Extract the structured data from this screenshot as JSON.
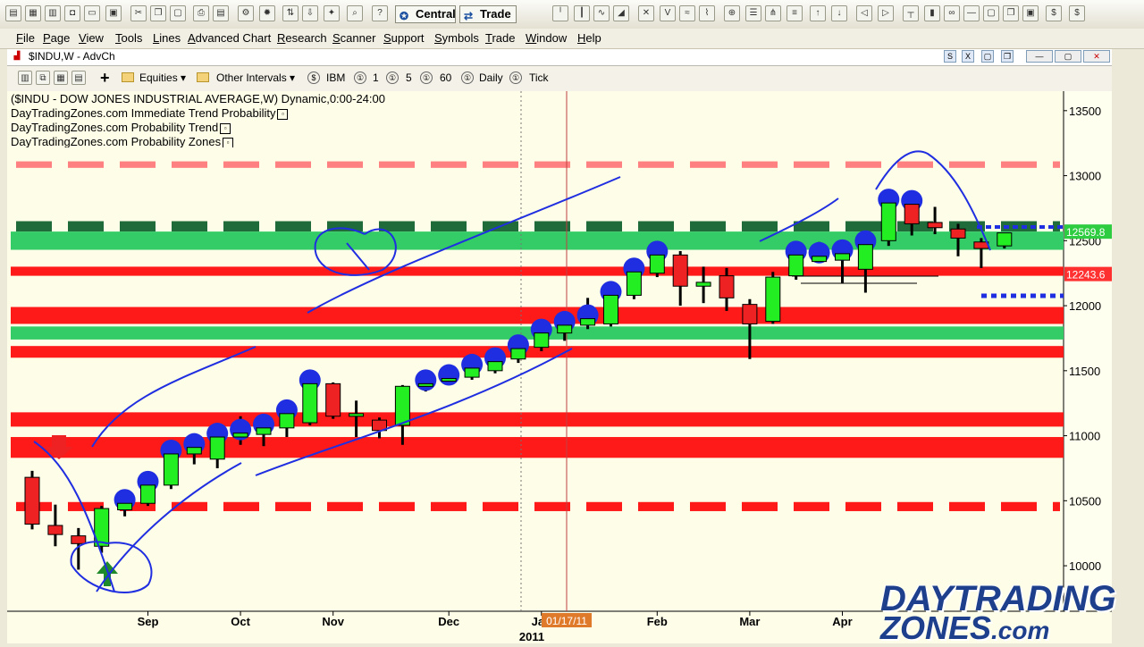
{
  "toolbar": {
    "central_label": "Central",
    "trade_label": "Trade"
  },
  "menu": [
    "File",
    "Page",
    "View",
    "Tools",
    "Lines",
    "Advanced Chart",
    "Research",
    "Scanner",
    "Support",
    "Symbols",
    "Trade",
    "Window",
    "Help"
  ],
  "window": {
    "title": "$INDU,W - AdvCh"
  },
  "chart_toolbar": {
    "equities": "Equities",
    "other_intervals": "Other Intervals",
    "symbol": "IBM",
    "intervals": [
      "1",
      "5",
      "60"
    ],
    "daily": "Daily",
    "tick": "Tick"
  },
  "overlay": {
    "line1": "($INDU - DOW JONES INDUSTRIAL AVERAGE,W) Dynamic,0:00-24:00",
    "line2": "DayTradingZones.com Immediate Trend Probability",
    "line3": "DayTradingZones.com Probability Trend",
    "line4": "DayTradingZones.com Probability Zones"
  },
  "chart_data": {
    "type": "candlestick",
    "y_ticks": [
      13500,
      13000,
      12500,
      12000,
      11500,
      11000,
      10500,
      10000
    ],
    "ylim": [
      9650,
      13650
    ],
    "x_labels": [
      {
        "label": "Sep",
        "index": 5
      },
      {
        "label": "Oct",
        "index": 9
      },
      {
        "label": "Nov",
        "index": 13
      },
      {
        "label": "Dec",
        "index": 18
      },
      {
        "label": "Jan",
        "index": 22
      },
      {
        "label": "Feb",
        "index": 27
      },
      {
        "label": "Mar",
        "index": 31
      },
      {
        "label": "Apr",
        "index": 35
      }
    ],
    "year_label": "2011",
    "cursor_date": "01/17/11",
    "price_labels": [
      {
        "value": 12569.8,
        "text": "12569.8",
        "color": "#2ecc40"
      },
      {
        "value": 12243.6,
        "text": "12243.6",
        "color": "#ff3030"
      }
    ],
    "zones": [
      {
        "lo": 13060,
        "hi": 13110,
        "color": "#ff8080",
        "dashed": true
      },
      {
        "lo": 12570,
        "hi": 12650,
        "color": "#1f6b3a",
        "dashed": true
      },
      {
        "lo": 12430,
        "hi": 12570,
        "color": "#33cc66",
        "dashed": false
      },
      {
        "lo": 12230,
        "hi": 12300,
        "color": "#ff1a1a",
        "dashed": false
      },
      {
        "lo": 11860,
        "hi": 11990,
        "color": "#ff1a1a",
        "dashed": false
      },
      {
        "lo": 11740,
        "hi": 11840,
        "color": "#33cc66",
        "dashed": false
      },
      {
        "lo": 11600,
        "hi": 11690,
        "color": "#ff1a1a",
        "dashed": false
      },
      {
        "lo": 11070,
        "hi": 11180,
        "color": "#ff1a1a",
        "dashed": false
      },
      {
        "lo": 10830,
        "hi": 10990,
        "color": "#ff1a1a",
        "dashed": false
      },
      {
        "lo": 10420,
        "hi": 10490,
        "color": "#ff1a1a",
        "dashed": true
      }
    ],
    "candles": [
      {
        "o": 10680,
        "h": 10730,
        "l": 10280,
        "c": 10320,
        "dot": false
      },
      {
        "o": 10310,
        "h": 10470,
        "l": 10150,
        "c": 10240,
        "dot": false
      },
      {
        "o": 10230,
        "h": 10290,
        "l": 9970,
        "c": 10170,
        "dot": false
      },
      {
        "o": 10150,
        "h": 10460,
        "l": 10100,
        "c": 10440,
        "dot": false
      },
      {
        "o": 10430,
        "h": 10550,
        "l": 10380,
        "c": 10480,
        "dot": true
      },
      {
        "o": 10480,
        "h": 10690,
        "l": 10460,
        "c": 10620,
        "dot": true
      },
      {
        "o": 10620,
        "h": 10880,
        "l": 10590,
        "c": 10860,
        "dot": true
      },
      {
        "o": 10860,
        "h": 10960,
        "l": 10780,
        "c": 10910,
        "dot": true
      },
      {
        "o": 10820,
        "h": 11010,
        "l": 10750,
        "c": 10990,
        "dot": true
      },
      {
        "o": 10990,
        "h": 11150,
        "l": 10930,
        "c": 11020,
        "dot": true
      },
      {
        "o": 11010,
        "h": 11160,
        "l": 10920,
        "c": 11060,
        "dot": true
      },
      {
        "o": 11060,
        "h": 11190,
        "l": 10990,
        "c": 11170,
        "dot": true
      },
      {
        "o": 11100,
        "h": 11420,
        "l": 11080,
        "c": 11400,
        "dot": true
      },
      {
        "o": 11400,
        "h": 11410,
        "l": 11130,
        "c": 11150,
        "dot": false
      },
      {
        "o": 11150,
        "h": 11270,
        "l": 10990,
        "c": 11170,
        "dot": false
      },
      {
        "o": 11120,
        "h": 11140,
        "l": 10980,
        "c": 11040,
        "dot": false
      },
      {
        "o": 11080,
        "h": 11390,
        "l": 10930,
        "c": 11380,
        "dot": false
      },
      {
        "o": 11380,
        "h": 11440,
        "l": 11340,
        "c": 11400,
        "dot": true
      },
      {
        "o": 11430,
        "h": 11520,
        "l": 11400,
        "c": 11440,
        "dot": true
      },
      {
        "o": 11450,
        "h": 11580,
        "l": 11430,
        "c": 11520,
        "dot": true
      },
      {
        "o": 11500,
        "h": 11650,
        "l": 11480,
        "c": 11570,
        "dot": true
      },
      {
        "o": 11590,
        "h": 11720,
        "l": 11560,
        "c": 11670,
        "dot": true
      },
      {
        "o": 11680,
        "h": 11840,
        "l": 11650,
        "c": 11790,
        "dot": true
      },
      {
        "o": 11790,
        "h": 11920,
        "l": 11730,
        "c": 11850,
        "dot": true
      },
      {
        "o": 11850,
        "h": 12060,
        "l": 11820,
        "c": 11900,
        "dot": true
      },
      {
        "o": 11860,
        "h": 12100,
        "l": 11840,
        "c": 12080,
        "dot": true
      },
      {
        "o": 12080,
        "h": 12280,
        "l": 12050,
        "c": 12260,
        "dot": true
      },
      {
        "o": 12250,
        "h": 12400,
        "l": 12220,
        "c": 12390,
        "dot": true
      },
      {
        "o": 12390,
        "h": 12420,
        "l": 12000,
        "c": 12150,
        "dot": false
      },
      {
        "o": 12150,
        "h": 12300,
        "l": 12020,
        "c": 12180,
        "dot": false
      },
      {
        "o": 12230,
        "h": 12290,
        "l": 11960,
        "c": 12060,
        "dot": false
      },
      {
        "o": 12010,
        "h": 12050,
        "l": 11590,
        "c": 11860,
        "dot": false
      },
      {
        "o": 11880,
        "h": 12260,
        "l": 11860,
        "c": 12220,
        "dot": false
      },
      {
        "o": 12230,
        "h": 12420,
        "l": 12200,
        "c": 12390,
        "dot": true
      },
      {
        "o": 12340,
        "h": 12490,
        "l": 12330,
        "c": 12380,
        "dot": true
      },
      {
        "o": 12350,
        "h": 12490,
        "l": 12170,
        "c": 12400,
        "dot": true
      },
      {
        "o": 12280,
        "h": 12560,
        "l": 12100,
        "c": 12470,
        "dot": true
      },
      {
        "o": 12500,
        "h": 12800,
        "l": 12460,
        "c": 12790,
        "dot": true
      },
      {
        "o": 12780,
        "h": 12880,
        "l": 12540,
        "c": 12630,
        "dot": true
      },
      {
        "o": 12640,
        "h": 12760,
        "l": 12550,
        "c": 12600,
        "dot": false
      },
      {
        "o": 12590,
        "h": 12630,
        "l": 12380,
        "c": 12520,
        "dot": false
      },
      {
        "o": 12490,
        "h": 12520,
        "l": 12290,
        "c": 12440,
        "dot": false
      },
      {
        "o": 12460,
        "h": 12560,
        "l": 12440,
        "c": 12560,
        "dot": false
      }
    ]
  }
}
